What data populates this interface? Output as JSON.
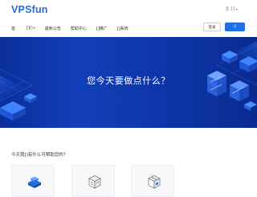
{
  "header": {
    "logo": "VPSfun",
    "user_label": "[]",
    "user_chevron": "▾",
    "nav": [
      {
        "label": "首"
      },
      {
        "label": "[]()",
        "chevron": "▾"
      },
      {
        "label": "最新公告"
      },
      {
        "label": "帮助中心"
      },
      {
        "label": "[]推广"
      },
      {
        "label": "[]系统"
      }
    ],
    "login_label": "登录",
    "register_label": "[]"
  },
  "hero": {
    "title": "您今天要做点什么？"
  },
  "main": {
    "section_title": "今天我[]有什么可帮助您的？"
  },
  "colors": {
    "accent": "#1f6fe0",
    "hero_bg": "#0d34a6"
  }
}
